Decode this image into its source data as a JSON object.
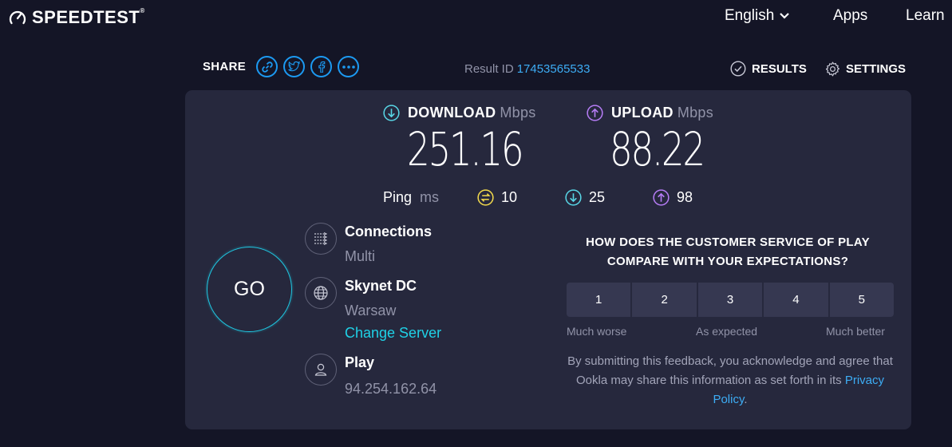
{
  "brand": {
    "name": "SPEEDTEST",
    "mark": "®"
  },
  "nav": {
    "language": "English",
    "apps": "Apps",
    "learn": "Learn"
  },
  "share": {
    "label": "SHARE",
    "buttons": [
      "link-icon",
      "twitter-icon",
      "facebook-icon",
      "more-icon"
    ]
  },
  "result": {
    "label": "Result ID",
    "id": "17453565533"
  },
  "toolbar": {
    "results": "RESULTS",
    "settings": "SETTINGS"
  },
  "download": {
    "label": "DOWNLOAD",
    "unit": "Mbps",
    "value": "251.16"
  },
  "upload": {
    "label": "UPLOAD",
    "unit": "Mbps",
    "value": "88.22"
  },
  "ping": {
    "label": "Ping",
    "unit": "ms",
    "idle": "10",
    "download": "25",
    "upload": "98"
  },
  "go": {
    "label": "GO"
  },
  "connections": {
    "title": "Connections",
    "value": "Multi"
  },
  "server": {
    "name": "Skynet DC",
    "location": "Warsaw",
    "change": "Change Server"
  },
  "provider": {
    "name": "Play",
    "ip": "94.254.162.64"
  },
  "survey": {
    "question": "HOW DOES THE CUSTOMER SERVICE OF PLAY COMPARE WITH YOUR EXPECTATIONS?",
    "ratings": [
      "1",
      "2",
      "3",
      "4",
      "5"
    ],
    "low": "Much worse",
    "mid": "As expected",
    "high": "Much better",
    "disclaimer_pre": "By submitting this feedback, you acknowledge and agree that Ookla may share this information as set forth in its",
    "privacy_link": "Privacy Policy",
    "disclaimer_post": "."
  },
  "colors": {
    "background": "#141526",
    "panel": "#26283d",
    "accent_blue": "#1c9af2",
    "download_teal": "#58d6e6",
    "upload_purple": "#b57cf5",
    "ping_yellow": "#f3da4c",
    "go_ring": "#1fc6e0"
  }
}
